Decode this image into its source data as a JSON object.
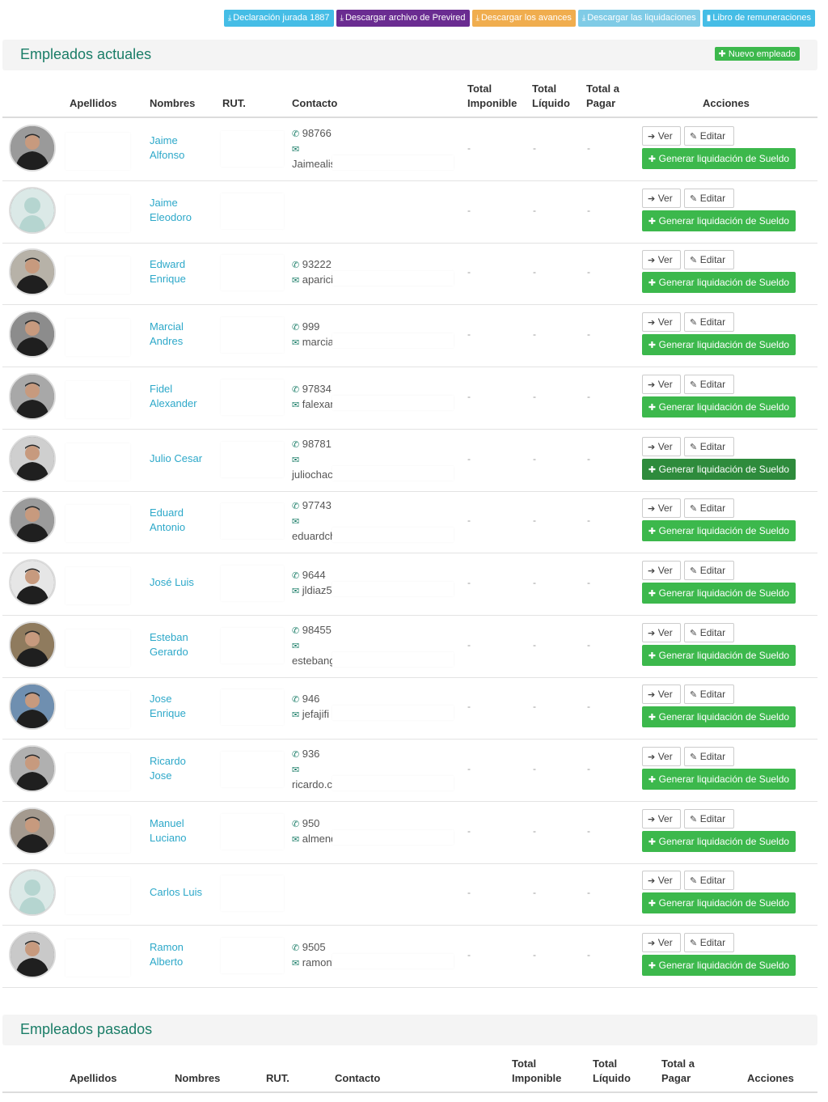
{
  "toolbar": [
    {
      "label": "Declaración jurada 1887",
      "color": "#45bde6"
    },
    {
      "label": "Descargar archivo de Previred",
      "color": "#6a2c91"
    },
    {
      "label": "Descargar los avances",
      "color": "#f0ad4e"
    },
    {
      "label": "Descargar las liquidaciones",
      "color": "#7fcbe6"
    },
    {
      "label": "Libro de remuneraciones",
      "color": "#45bde6"
    }
  ],
  "current": {
    "title": "Empleados actuales",
    "new_button": "Nuevo empleado",
    "headers": {
      "apellidos": "Apellidos",
      "nombres": "Nombres",
      "rut": "RUT.",
      "contacto": "Contacto",
      "imponible": "Total\nImponible",
      "liquido": "Total\nLíquido",
      "pagar": "Total a\nPagar",
      "acciones": "Acciones"
    },
    "actions": {
      "ver": "Ver",
      "editar": "Editar",
      "generar": "Generar liquidación de Sueldo"
    },
    "employees": [
      {
        "first": "Jaime",
        "second": "Alfonso",
        "phone": "98766",
        "email": "Jaimealis",
        "email_wrap": true,
        "avatar": "photo"
      },
      {
        "first": "Jaime",
        "second": "Eleodoro",
        "phone": "",
        "email": "",
        "email_wrap": false,
        "avatar": "placeholder"
      },
      {
        "first": "Edward",
        "second": "Enrique",
        "phone": "93222",
        "email": "aparicioedw",
        "email_wrap": false,
        "avatar": "photo"
      },
      {
        "first": "Marcial",
        "second": "Andres",
        "phone": "999",
        "email": "marcialc_",
        "email_wrap": false,
        "avatar": "photo"
      },
      {
        "first": "Fidel",
        "second": "Alexander",
        "phone": "97834",
        "email": "falexande",
        "email_wrap": false,
        "avatar": "photo"
      },
      {
        "first": "Julio Cesar",
        "second": "",
        "phone": "98781",
        "email": "juliochacor",
        "email_wrap": true,
        "avatar": "photo"
      },
      {
        "first": "Eduard",
        "second": "Antonio",
        "phone": "97743",
        "email": "eduardchav",
        "email_wrap": true,
        "avatar": "photo"
      },
      {
        "first": "José Luis",
        "second": "",
        "phone": "9644",
        "email": "jldiaz5",
        "email_wrap": false,
        "avatar": "photo"
      },
      {
        "first": "Esteban",
        "second": "Gerardo",
        "phone": "98455",
        "email": "estebangei",
        "email_wrap": true,
        "avatar": "photo"
      },
      {
        "first": "Jose",
        "second": "Enrique",
        "phone": "946",
        "email": "jefajifi",
        "email_wrap": false,
        "avatar": "photo"
      },
      {
        "first": "Ricardo",
        "second": "Jose",
        "phone": "936",
        "email": "ricardo.cara",
        "email_wrap": true,
        "avatar": "photo"
      },
      {
        "first": "Manuel",
        "second": "Luciano",
        "phone": "950",
        "email": "almend",
        "email_wrap": false,
        "avatar": "photo"
      },
      {
        "first": "Carlos Luis",
        "second": "",
        "phone": "",
        "email": "",
        "email_wrap": false,
        "avatar": "placeholder"
      },
      {
        "first": "Ramon",
        "second": "Alberto",
        "phone": "9505",
        "email": "ramonv",
        "email_wrap": false,
        "avatar": "photo"
      }
    ],
    "dash": "-"
  },
  "past": {
    "title": "Empleados pasados",
    "headers": {
      "apellidos": "Apellidos",
      "nombres": "Nombres",
      "rut": "RUT.",
      "contacto": "Contacto",
      "imponible": "Total\nImponible",
      "liquido": "Total\nLíquido",
      "pagar": "Total a\nPagar",
      "acciones": "Acciones"
    }
  },
  "icons": {
    "download": "download-icon",
    "book": "book-icon",
    "plus": "plus-icon",
    "phone": "phone-icon",
    "envelope": "envelope-icon",
    "arrow": "arrow-right-icon",
    "pencil": "pencil-icon"
  }
}
